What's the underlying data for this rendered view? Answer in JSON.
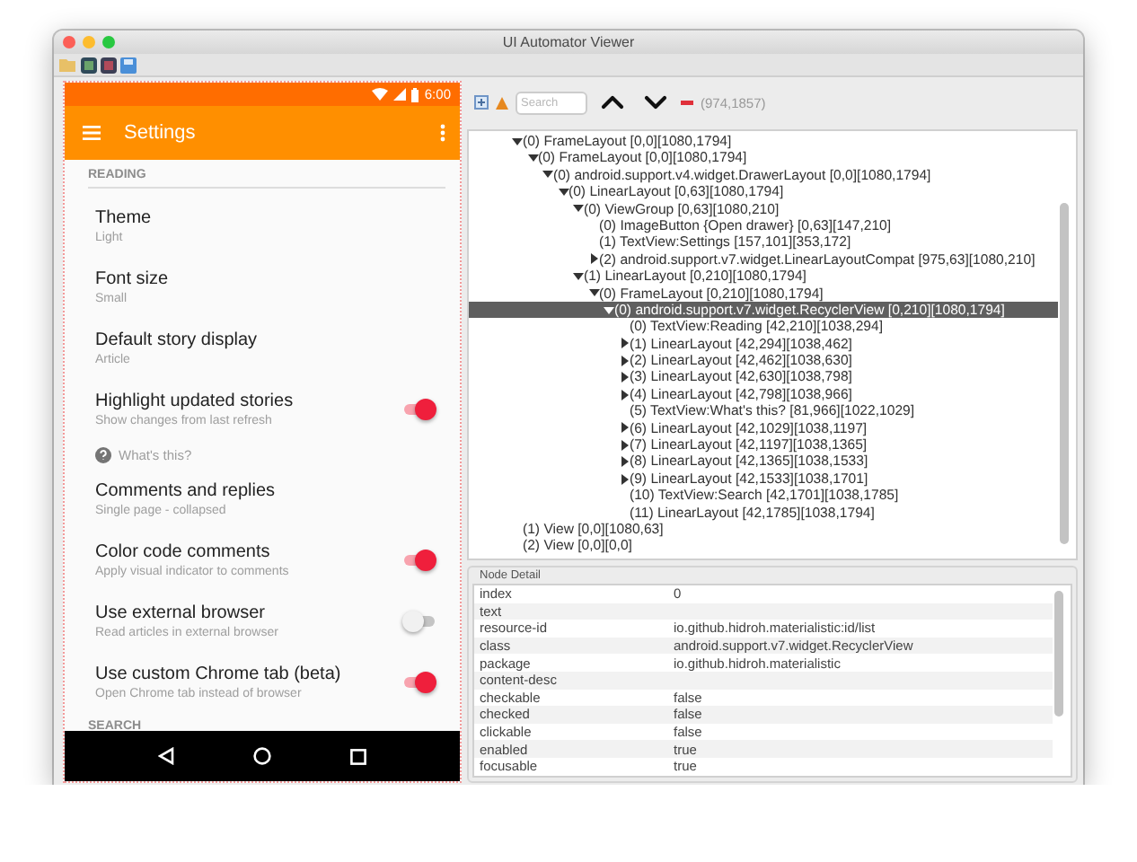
{
  "window": {
    "title": "UI Automator Viewer"
  },
  "phone": {
    "status_bar": {
      "time": "6:00"
    },
    "app_bar": {
      "title": "Settings"
    },
    "settings": [
      {
        "kind": "header",
        "label": "READING"
      },
      {
        "kind": "item",
        "title": "Theme",
        "summary": "Light"
      },
      {
        "kind": "item",
        "title": "Font size",
        "summary": "Small"
      },
      {
        "kind": "item",
        "title": "Default story display",
        "summary": "Article"
      },
      {
        "kind": "switch",
        "title": "Highlight updated stories",
        "summary": "Show changes from last refresh",
        "on": true
      },
      {
        "kind": "help",
        "label": "What's this?"
      },
      {
        "kind": "item",
        "title": "Comments and replies",
        "summary": "Single page - collapsed"
      },
      {
        "kind": "switch",
        "title": "Color code comments",
        "summary": "Apply visual indicator to comments",
        "on": true
      },
      {
        "kind": "switch",
        "title": "Use external browser",
        "summary": "Read articles in external browser",
        "on": false
      },
      {
        "kind": "switch",
        "title": "Use custom Chrome tab (beta)",
        "summary": "Open Chrome tab instead of browser",
        "on": true
      },
      {
        "kind": "header",
        "label": "SEARCH"
      }
    ]
  },
  "hierarchy": {
    "search": {
      "placeholder": "Search"
    },
    "coordinates": "(974,1857)",
    "tree": [
      {
        "label": "(0) FrameLayout [0,0][1080,1794]",
        "expanded": true,
        "selected": false,
        "children": [
          {
            "label": "(0) FrameLayout [0,0][1080,1794]",
            "expanded": true,
            "selected": false,
            "children": [
              {
                "label": "(0) android.support.v4.widget.DrawerLayout [0,0][1080,1794]",
                "expanded": true,
                "selected": false,
                "children": [
                  {
                    "label": "(0) LinearLayout [0,63][1080,1794]",
                    "expanded": true,
                    "selected": false,
                    "children": [
                      {
                        "label": "(0) ViewGroup [0,63][1080,210]",
                        "expanded": true,
                        "selected": false,
                        "children": [
                          {
                            "label": "(0) ImageButton {Open drawer} [0,63][147,210]",
                            "selected": false
                          },
                          {
                            "label": "(1) TextView:Settings [157,101][353,172]",
                            "selected": false
                          },
                          {
                            "label": "(2) android.support.v7.widget.LinearLayoutCompat [975,63][1080,210]",
                            "expanded": false,
                            "selected": false
                          }
                        ]
                      },
                      {
                        "label": "(1) LinearLayout [0,210][1080,1794]",
                        "expanded": true,
                        "selected": false,
                        "children": [
                          {
                            "label": "(0) FrameLayout [0,210][1080,1794]",
                            "expanded": true,
                            "selected": false,
                            "children": [
                              {
                                "label": "(0) android.support.v7.widget.RecyclerView [0,210][1080,1794]",
                                "expanded": true,
                                "selected": true,
                                "children": [
                                  {
                                    "label": "(0) TextView:Reading [42,210][1038,294]",
                                    "selected": false
                                  },
                                  {
                                    "label": "(1) LinearLayout [42,294][1038,462]",
                                    "expanded": false,
                                    "selected": false
                                  },
                                  {
                                    "label": "(2) LinearLayout [42,462][1038,630]",
                                    "expanded": false,
                                    "selected": false
                                  },
                                  {
                                    "label": "(3) LinearLayout [42,630][1038,798]",
                                    "expanded": false,
                                    "selected": false
                                  },
                                  {
                                    "label": "(4) LinearLayout [42,798][1038,966]",
                                    "expanded": false,
                                    "selected": false
                                  },
                                  {
                                    "label": "(5) TextView:What's this? [81,966][1022,1029]",
                                    "selected": false
                                  },
                                  {
                                    "label": "(6) LinearLayout [42,1029][1038,1197]",
                                    "expanded": false,
                                    "selected": false
                                  },
                                  {
                                    "label": "(7) LinearLayout [42,1197][1038,1365]",
                                    "expanded": false,
                                    "selected": false
                                  },
                                  {
                                    "label": "(8) LinearLayout [42,1365][1038,1533]",
                                    "expanded": false,
                                    "selected": false
                                  },
                                  {
                                    "label": "(9) LinearLayout [42,1533][1038,1701]",
                                    "expanded": false,
                                    "selected": false
                                  },
                                  {
                                    "label": "(10) TextView:Search [42,1701][1038,1785]",
                                    "selected": false
                                  },
                                  {
                                    "label": "(11) LinearLayout [42,1785][1038,1794]",
                                    "selected": false
                                  }
                                ]
                              }
                            ]
                          }
                        ]
                      }
                    ]
                  }
                ]
              }
            ]
          }
        ]
      },
      {
        "label": "(1) View [0,0][1080,63]",
        "selected": false
      },
      {
        "label": "(2) View [0,0][0,0]",
        "selected": false
      }
    ]
  },
  "node_detail": {
    "title": "Node Detail",
    "rows": [
      {
        "key": "index",
        "value": "0"
      },
      {
        "key": "text"
      },
      {
        "key": "resource-id",
        "value": "io.github.hidroh.materialistic:id/list"
      },
      {
        "key": "class",
        "value": "android.support.v7.widget.RecyclerView"
      },
      {
        "key": "package",
        "value": "io.github.hidroh.materialistic"
      },
      {
        "key": "content-desc"
      },
      {
        "key": "checkable",
        "value": "false"
      },
      {
        "key": "checked",
        "value": "false"
      },
      {
        "key": "clickable",
        "value": "false"
      },
      {
        "key": "enabled",
        "value": "true"
      },
      {
        "key": "focusable",
        "value": "true"
      }
    ]
  }
}
